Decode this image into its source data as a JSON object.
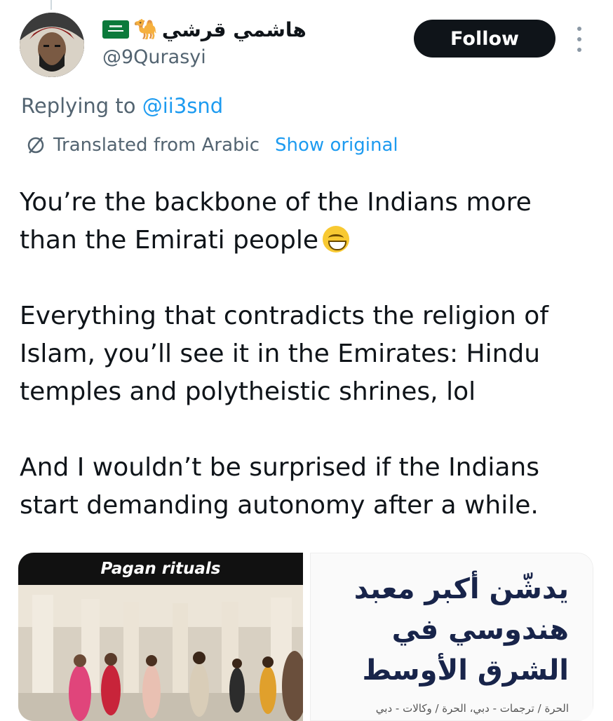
{
  "author": {
    "display_name": "هاشمي قرشي",
    "handle": "@9Qurasyi",
    "flag_icon": "saudi-flag-icon",
    "camel_icon": "camel-icon"
  },
  "follow_label": "Follow",
  "reply_prefix": "Replying to",
  "reply_to": "@ii3snd",
  "translation": {
    "label": "Translated from Arabic",
    "show_original": "Show original"
  },
  "tweet": {
    "p1": "You’re the backbone of the Indians more than the Emirati people",
    "p2": "Everything that contradicts the religion of Islam, you’ll see it in the Emirates: Hindu temples and polytheistic shrines, lol",
    "p3": "And I wouldn’t be surprised if the Indians start demanding autonomy after a while."
  },
  "media": {
    "left_banner": "Pagan rituals",
    "right_lines": [
      "يدشّن أكبر معبد",
      "هندوسي في",
      "الشرق الأوسط"
    ],
    "right_source": "الحرة / ترجمات - دبي، الحرة / وكالات - دبي"
  },
  "colors": {
    "link": "#1d9bf0",
    "muted": "#536471",
    "button": "#0f1419"
  }
}
